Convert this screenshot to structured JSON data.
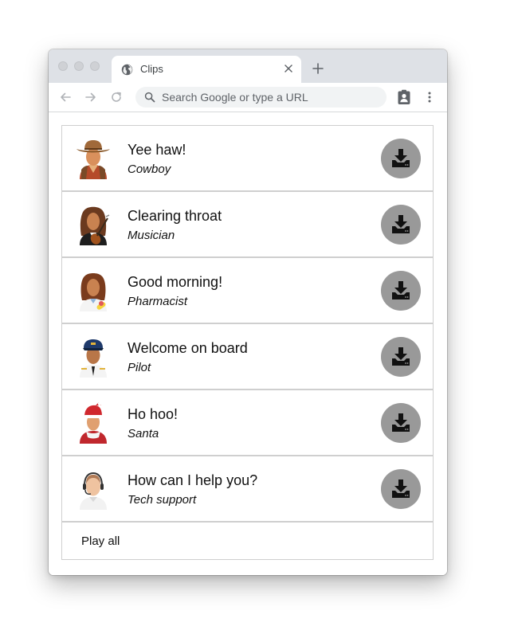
{
  "browser": {
    "tab_title": "Clips",
    "omnibox_placeholder": "Search Google or type a URL"
  },
  "clips": [
    {
      "title": "Yee haw!",
      "character": "Cowboy",
      "icon": "cowboy-avatar-icon"
    },
    {
      "title": "Clearing throat",
      "character": "Musician",
      "icon": "musician-avatar-icon"
    },
    {
      "title": "Good morning!",
      "character": "Pharmacist",
      "icon": "pharmacist-avatar-icon"
    },
    {
      "title": "Welcome on board",
      "character": "Pilot",
      "icon": "pilot-avatar-icon"
    },
    {
      "title": "Ho hoo!",
      "character": "Santa",
      "icon": "santa-avatar-icon"
    },
    {
      "title": "How can I help you?",
      "character": "Tech support",
      "icon": "tech-support-avatar-icon"
    }
  ],
  "play_all_label": "Play all",
  "colors": {
    "download_button": "#999999",
    "tabbar": "#dee1e6",
    "omnibox": "#f1f3f4",
    "row_border": "#cfcfcf"
  },
  "icons": {
    "download": "download-icon",
    "tab": "globe-icon",
    "close": "close-icon",
    "new_tab": "plus-icon",
    "back": "back-arrow-icon",
    "forward": "forward-arrow-icon",
    "reload": "reload-icon",
    "search": "search-icon",
    "extension": "clipboard-person-icon",
    "menu": "kebab-menu-icon"
  }
}
